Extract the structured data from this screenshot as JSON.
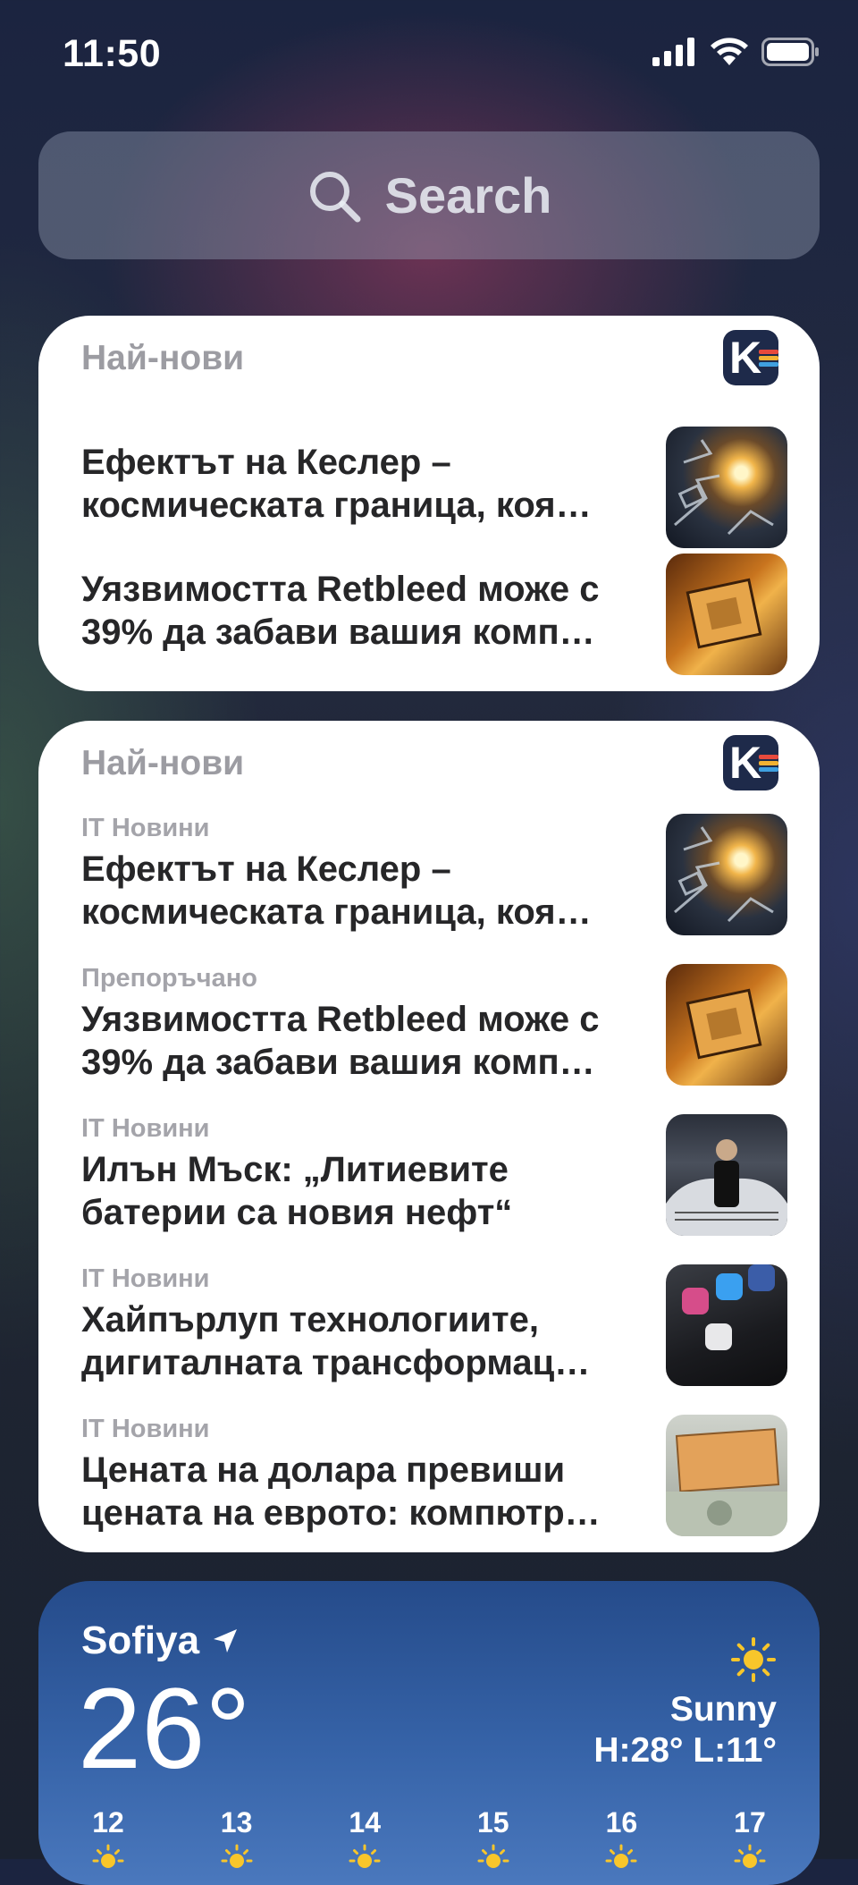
{
  "status_bar": {
    "time": "11:50"
  },
  "search": {
    "placeholder": "Search"
  },
  "widget1": {
    "title": "Най-нови",
    "app_icon": "kaldata-logo",
    "stories": [
      {
        "headline_line1": "Ефектът на Кеслер –",
        "headline_line2": "космическата граница, коя…",
        "thumb_icon": "space-debris-image"
      },
      {
        "headline_line1": "Уязвимостта Retbleed може с",
        "headline_line2": "39% да забави вашия комп…",
        "thumb_icon": "cpu-chip-image"
      }
    ]
  },
  "widget2": {
    "title": "Най-нови",
    "app_icon": "kaldata-logo",
    "stories": [
      {
        "category": "IT Новини",
        "headline_line1": "Ефектът на Кеслер –",
        "headline_line2": "космическата граница, коя…",
        "thumb_icon": "space-debris-image"
      },
      {
        "category": "Препоръчано",
        "headline_line1": "Уязвимостта Retbleed може с",
        "headline_line2": "39% да забави вашия комп…",
        "thumb_icon": "cpu-chip-image"
      },
      {
        "category": "IT Новини",
        "headline_line1": "Илън Мъск: „Литиевите",
        "headline_line2": "батерии са новия нефт“",
        "thumb_icon": "presenter-car-image"
      },
      {
        "category": "IT Новини",
        "headline_line1": "Хайпърлуп технологиите,",
        "headline_line2": "дигиталната трансформац…",
        "thumb_icon": "social-apps-phone-image"
      },
      {
        "category": "IT Новини",
        "headline_line1": "Цената на долара превиши",
        "headline_line2": "цената на еврото: компютр…",
        "thumb_icon": "banknotes-image"
      }
    ]
  },
  "weather": {
    "city": "Sofiya",
    "temperature": "26°",
    "condition": "Sunny",
    "hi_lo": "H:28° L:11°",
    "hours": [
      "12",
      "13",
      "14",
      "15",
      "16",
      "17"
    ],
    "accent": "#f8c62b"
  }
}
